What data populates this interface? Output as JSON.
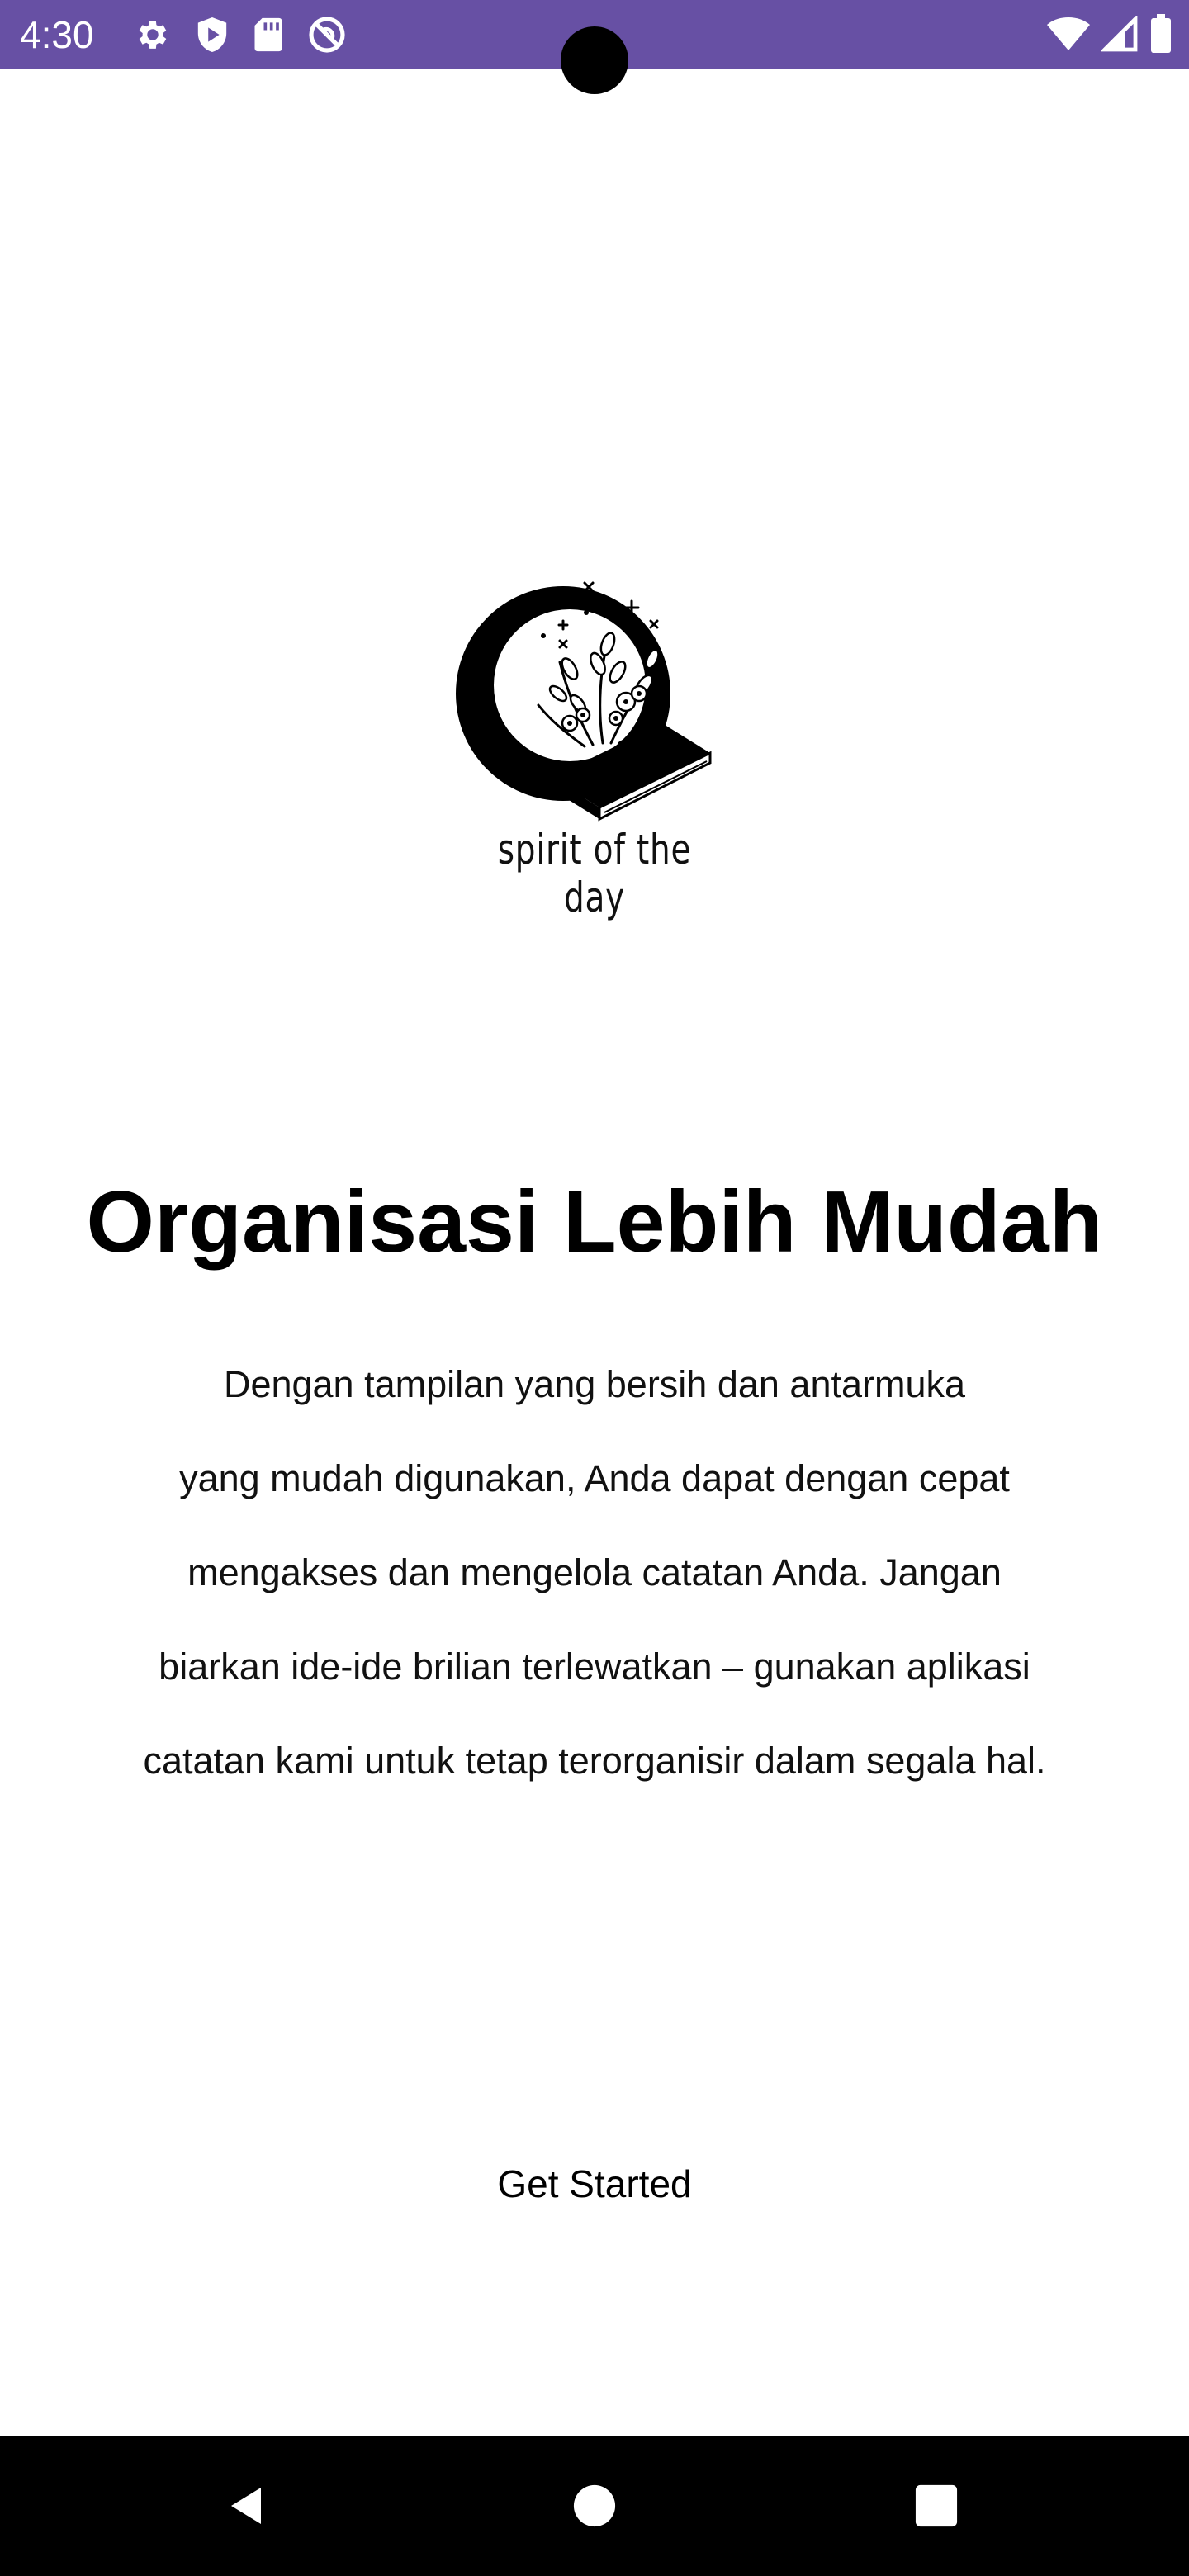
{
  "status_bar": {
    "time": "4:30",
    "left_icons": [
      "gear-icon",
      "shield-icon",
      "sd-card-icon",
      "do-not-disturb-icon"
    ],
    "right_icons": [
      "wifi-icon",
      "signal-icon",
      "battery-icon"
    ],
    "background": "#6750a4"
  },
  "logo": {
    "text": "spirit of the day"
  },
  "onboarding": {
    "title": "Organisasi Lebih Mudah",
    "description_lines": [
      "Dengan tampilan yang bersih dan antarmuka",
      "yang mudah digunakan, Anda dapat dengan cepat",
      "mengakses dan mengelola catatan Anda. Jangan",
      "biarkan ide-ide brilian terlewatkan – gunakan aplikasi",
      "catatan kami untuk tetap terorganisir dalam segala hal."
    ],
    "cta_label": "Get Started"
  },
  "nav_bar": {
    "buttons": [
      "back-icon",
      "home-icon",
      "recents-icon"
    ]
  }
}
